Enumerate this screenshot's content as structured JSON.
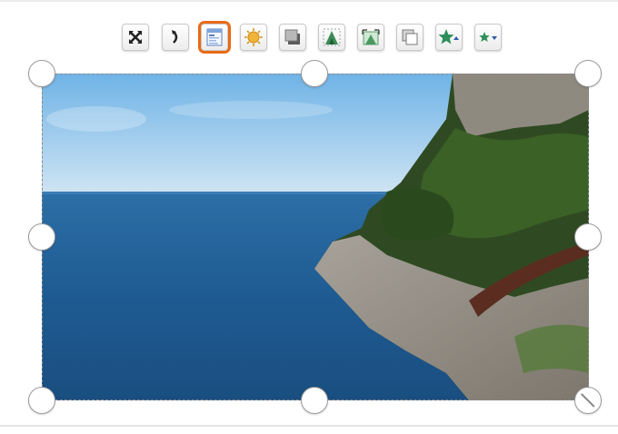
{
  "toolbar": {
    "buttons": [
      {
        "id": "expand",
        "icon": "expand-arrows-icon"
      },
      {
        "id": "flip",
        "icon": "flip-icon"
      },
      {
        "id": "properties",
        "icon": "image-properties-icon",
        "selected": true
      },
      {
        "id": "brightness",
        "icon": "brightness-icon"
      },
      {
        "id": "shadow",
        "icon": "shadow-icon"
      },
      {
        "id": "recolor",
        "icon": "recolor-icon"
      },
      {
        "id": "crop",
        "icon": "crop-icon"
      },
      {
        "id": "arrange",
        "icon": "arrange-icon"
      },
      {
        "id": "bring-forward",
        "icon": "star-up-icon"
      },
      {
        "id": "send-backward",
        "icon": "star-down-icon"
      }
    ],
    "selected_outline_color": "#ea6a17"
  },
  "image": {
    "subject": "coastal-cliff-and-sea-photo"
  },
  "selection": {
    "handles": [
      "top-left",
      "top-center",
      "top-right",
      "middle-left",
      "middle-right",
      "bottom-left",
      "bottom-center",
      "bottom-right"
    ]
  }
}
